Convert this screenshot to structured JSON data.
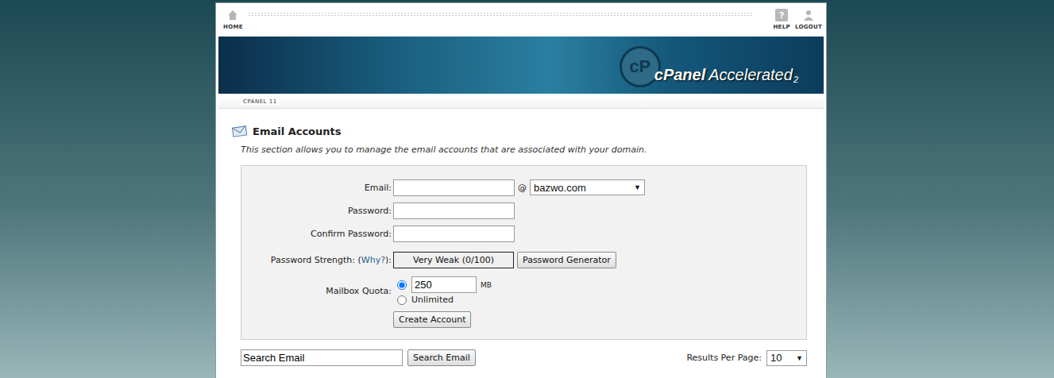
{
  "nav": {
    "home": "HOME",
    "help_glyph": "?",
    "help": "HELP",
    "logout": "LOGOUT"
  },
  "logo": {
    "emblem": "cP",
    "brand": "cPanel",
    "product": "Accelerated",
    "version": "2"
  },
  "breadcrumb": "CPANEL 11",
  "page": {
    "title": "Email Accounts",
    "description": "This section allows you to manage the email accounts that are associated with your domain."
  },
  "form": {
    "email": {
      "label": "Email:",
      "value": "",
      "at": "@",
      "domain": "bazwo.com",
      "arrow": "▼"
    },
    "password": {
      "label": "Password:",
      "value": ""
    },
    "confirm": {
      "label": "Confirm Password:",
      "value": ""
    },
    "strength": {
      "label_before": "Password Strength: (",
      "link": "Why?",
      "label_after": "):",
      "reading": "Very Weak (0/100)",
      "level": 0,
      "generator": "Password Generator"
    },
    "quota": {
      "label": "Mailbox Quota:",
      "options": [
        {
          "kind": "amount",
          "value": "250",
          "unit": "MB",
          "selected": true
        },
        {
          "kind": "plain",
          "label": "Unlimited",
          "selected": false
        }
      ]
    },
    "submit": "Create Account"
  },
  "search": {
    "value": "Search Email",
    "button": "Search Email",
    "per_page_label": "Results Per Page:",
    "per_page": "10",
    "arrow": "▼"
  }
}
